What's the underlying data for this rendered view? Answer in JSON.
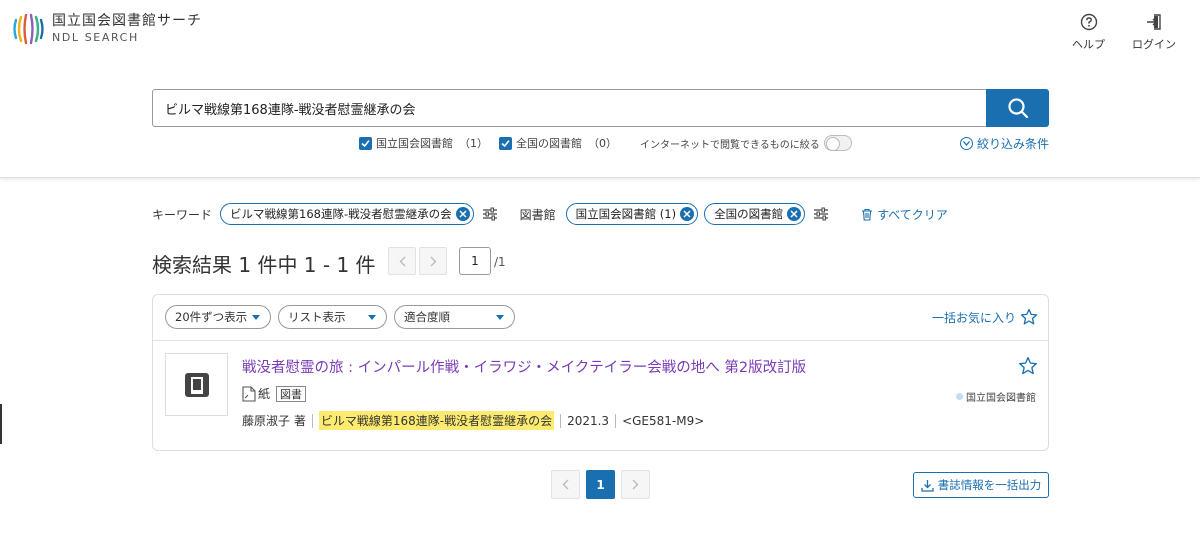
{
  "header": {
    "logo_jp": "国立国会図書館サーチ",
    "logo_en": "NDL SEARCH",
    "help_label": "ヘルプ",
    "login_label": "ログイン"
  },
  "search": {
    "query": "ビルマ戦線第168連隊-戦没者慰霊継承の会",
    "options": [
      {
        "label": "国立国会図書館",
        "count": "（1）",
        "checked": true
      },
      {
        "label": "全国の図書館",
        "count": "（0）",
        "checked": true
      }
    ],
    "internet_toggle_label": "インターネットで閲覧できるものに絞る",
    "refine_label": "絞り込み条件"
  },
  "filters": {
    "keyword_label": "キーワード",
    "keyword_chip": "ビルマ戦線第168連隊-戦没者慰霊継承の会",
    "library_label": "図書館",
    "library_chips": [
      "国立国会図書館 (1)",
      "全国の図書館"
    ],
    "clear_all_label": "すべてクリア"
  },
  "results": {
    "heading": "検索結果 1 件中 1 - 1 件",
    "page_input": "1",
    "page_total": "/1",
    "per_page": "20件ずつ表示",
    "view_mode": "リスト表示",
    "sort": "適合度順",
    "fav_all_label": "一括お気に入り",
    "items": [
      {
        "title": "戦没者慰霊の旅 : インパール作戦・イラワジ・メイクテイラー会戦の地へ 第2版改訂版",
        "media": "紙",
        "type_tag": "図書",
        "author": "藤原淑子 著",
        "publisher": "ビルマ戦線第168連隊-戦没者慰霊継承の会",
        "year": "2021.3",
        "call_number": "<GE581-M9>",
        "holder": "国立国会図書館"
      }
    ]
  },
  "pagination": {
    "current_page": "1",
    "export_label": "書誌情報を一括出力"
  },
  "colors": {
    "accent": "#1a6fb0",
    "title_link": "#7a3bb6",
    "highlight": "#fdeb6f"
  }
}
